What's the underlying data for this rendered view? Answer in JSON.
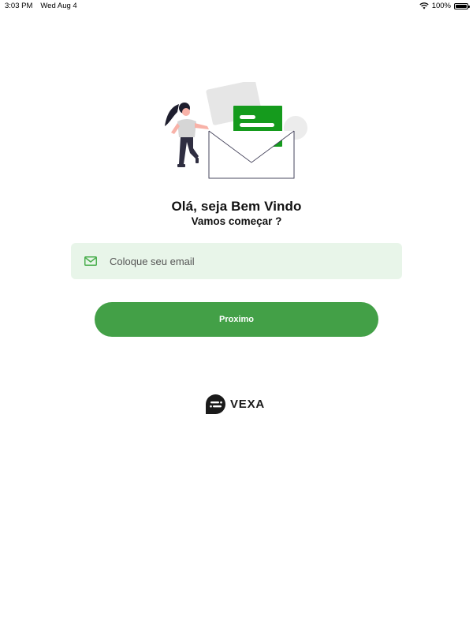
{
  "status_bar": {
    "time": "3:03 PM",
    "date": "Wed Aug 4",
    "battery": "100%",
    "icons": [
      "wifi-icon",
      "battery-icon"
    ]
  },
  "illustration": {
    "icon": "envelope-woman-illustration",
    "colors": {
      "accent": "#159b1d",
      "skin": "#f8b2a8",
      "hair": "#1e1e2e"
    }
  },
  "greeting": {
    "title": "Olá, seja Bem Vindo",
    "subtitle": "Vamos começar ?"
  },
  "email": {
    "placeholder": "Coloque seu email",
    "value": "",
    "icon": "mail-icon",
    "background": "#e8f5e9"
  },
  "next_button": {
    "label": "Proximo",
    "color": "#43a047"
  },
  "brand": {
    "name": "VEXA",
    "icon": "vexa-logo-icon"
  }
}
